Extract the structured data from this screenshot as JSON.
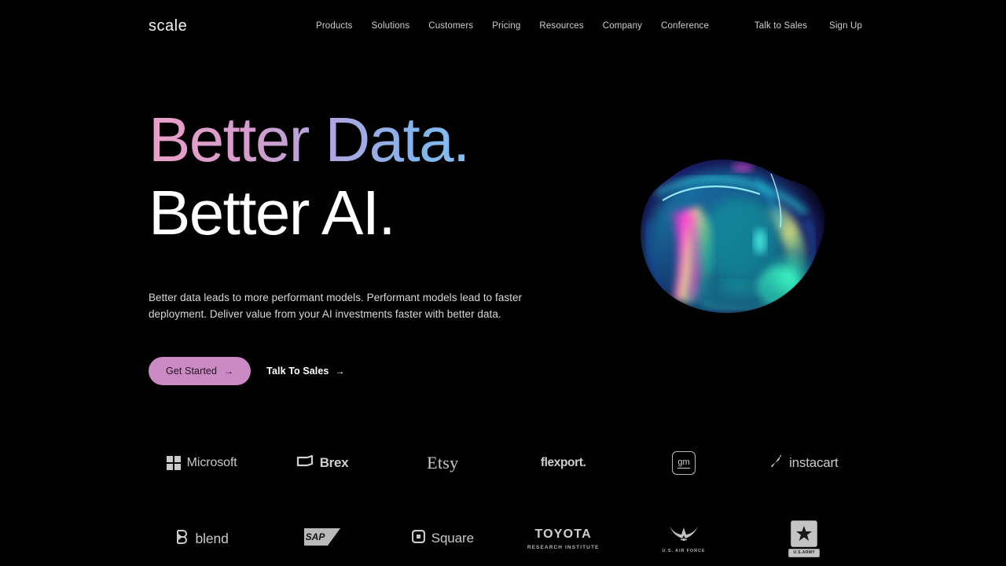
{
  "brand": {
    "logo_text": "scale"
  },
  "nav": {
    "center_items": [
      {
        "label": "Products"
      },
      {
        "label": "Solutions"
      },
      {
        "label": "Customers"
      },
      {
        "label": "Pricing"
      },
      {
        "label": "Resources"
      },
      {
        "label": "Company"
      },
      {
        "label": "Conference"
      }
    ],
    "right_items": [
      {
        "label": "Talk to Sales"
      },
      {
        "label": "Sign Up"
      }
    ]
  },
  "hero": {
    "headline_line1": "Better Data.",
    "headline_line2": "Better AI.",
    "subtitle": "Better data leads to more performant models. Performant models lead to faster deployment. Deliver value from your AI investments faster with better data.",
    "primary_cta": "Get Started",
    "secondary_cta": "Talk To Sales",
    "arrow_glyph": "→",
    "gradient_start": "#e9a0c6",
    "gradient_end": "#a8d4f5",
    "primary_cta_color": "#cb8ac3",
    "art_alt": "iridescent abstract blob"
  },
  "logos": [
    {
      "name": "Microsoft",
      "label": "Microsoft"
    },
    {
      "name": "Brex",
      "label": "Brex"
    },
    {
      "name": "Etsy",
      "label": "Etsy"
    },
    {
      "name": "Flexport",
      "label": "flexport."
    },
    {
      "name": "GM",
      "label": "gm"
    },
    {
      "name": "Instacart",
      "label": "instacart"
    },
    {
      "name": "Blend",
      "label": "blend"
    },
    {
      "name": "SAP",
      "label": "SAP"
    },
    {
      "name": "Square",
      "label": "Square"
    },
    {
      "name": "Toyota Research Institute",
      "label": "TOYOTA",
      "sublabel": "RESEARCH INSTITUTE"
    },
    {
      "name": "US Air Force",
      "label": "U.S. AIR FORCE"
    },
    {
      "name": "US Army",
      "label": "U.S.ARMY"
    }
  ]
}
